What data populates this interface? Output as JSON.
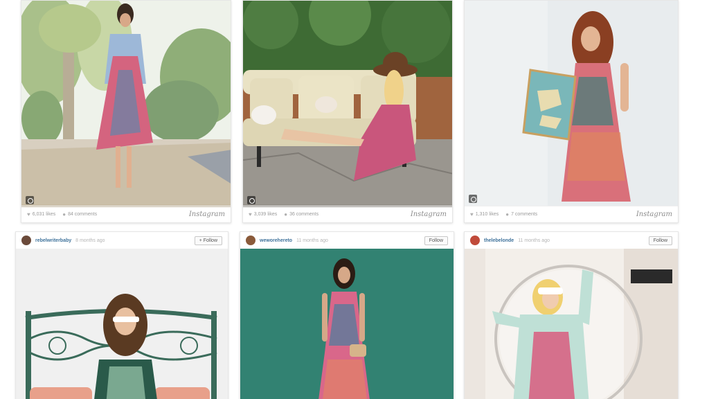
{
  "posts": [
    {
      "likes": "6,031 likes",
      "comments": "84 comments",
      "brand": "Instagram",
      "colors": {
        "sky": "#e9efe2",
        "trees": "#9bb58a",
        "ground": "#d9d2c5",
        "dress": "#d4647f",
        "jacket": "#9db8d8"
      }
    },
    {
      "likes": "3,039 likes",
      "comments": "36 comments",
      "brand": "Instagram",
      "colors": {
        "hedge": "#3e6b34",
        "sofa": "#e9e2c4",
        "stone": "#9a9690",
        "dress": "#c9567c",
        "hat": "#6b4226"
      }
    },
    {
      "likes": "1,310 likes",
      "comments": "7 comments",
      "brand": "Instagram",
      "colors": {
        "wall": "#e4e8ea",
        "dress": "#d9707a",
        "map": "#7ab7b9",
        "hair": "#8a3f22"
      }
    },
    {
      "username": "rebelwriterbaby",
      "time_ago": "8 months ago",
      "follow": "+ Follow",
      "colors": {
        "wall": "#eeeeee",
        "bed": "#3a6b5a",
        "hair": "#5a3a22",
        "pillow": "#e8a08a"
      }
    },
    {
      "username": "weworehereto",
      "time_ago": "11 months ago",
      "follow": "Follow",
      "colors": {
        "wall": "#2e7d6d",
        "dress": "#d9678a",
        "hair": "#2b1c14",
        "bag": "#d6b48a"
      }
    },
    {
      "username": "thelebelonde",
      "time_ago": "11 months ago",
      "follow": "Follow",
      "colors": {
        "bg": "#f1ece6",
        "jacket": "#bfe0d6",
        "hair": "#f0d070",
        "dress": "#d5708c"
      }
    }
  ]
}
